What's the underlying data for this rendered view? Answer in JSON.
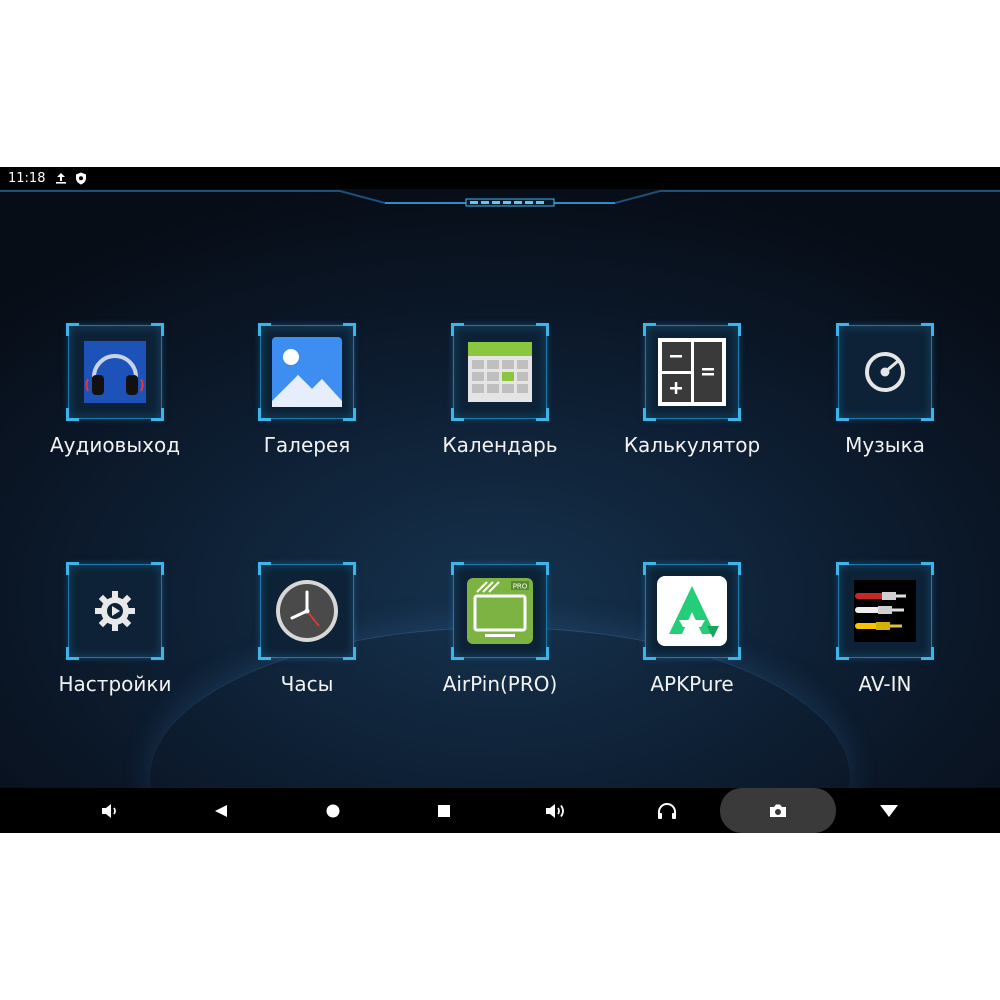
{
  "status_bar": {
    "time": "11:18",
    "icons": [
      "upload-icon",
      "shield-icon"
    ]
  },
  "apps": [
    {
      "label": "Аудиовыход",
      "icon": "headphones-icon"
    },
    {
      "label": "Галерея",
      "icon": "gallery-icon"
    },
    {
      "label": "Календарь",
      "icon": "calendar-icon"
    },
    {
      "label": "Калькулятор",
      "icon": "calculator-icon"
    },
    {
      "label": "Музыка",
      "icon": "music-icon"
    },
    {
      "label": "Настройки",
      "icon": "settings-icon"
    },
    {
      "label": "Часы",
      "icon": "clock-icon"
    },
    {
      "label": "AirPin(PRO)",
      "icon": "airpin-icon"
    },
    {
      "label": "APKPure",
      "icon": "apkpure-icon"
    },
    {
      "label": "AV-IN",
      "icon": "av-cables-icon"
    }
  ],
  "nav_bar": [
    "volume-down-icon",
    "back-icon",
    "home-icon",
    "recents-icon",
    "volume-up-icon",
    "headphones-icon",
    "camera-icon",
    "dropdown-icon"
  ],
  "colors": {
    "tile_border": "#1e78a8",
    "tile_corner": "#3fb4e8",
    "background": "#0e2035",
    "bar": "#000000"
  }
}
